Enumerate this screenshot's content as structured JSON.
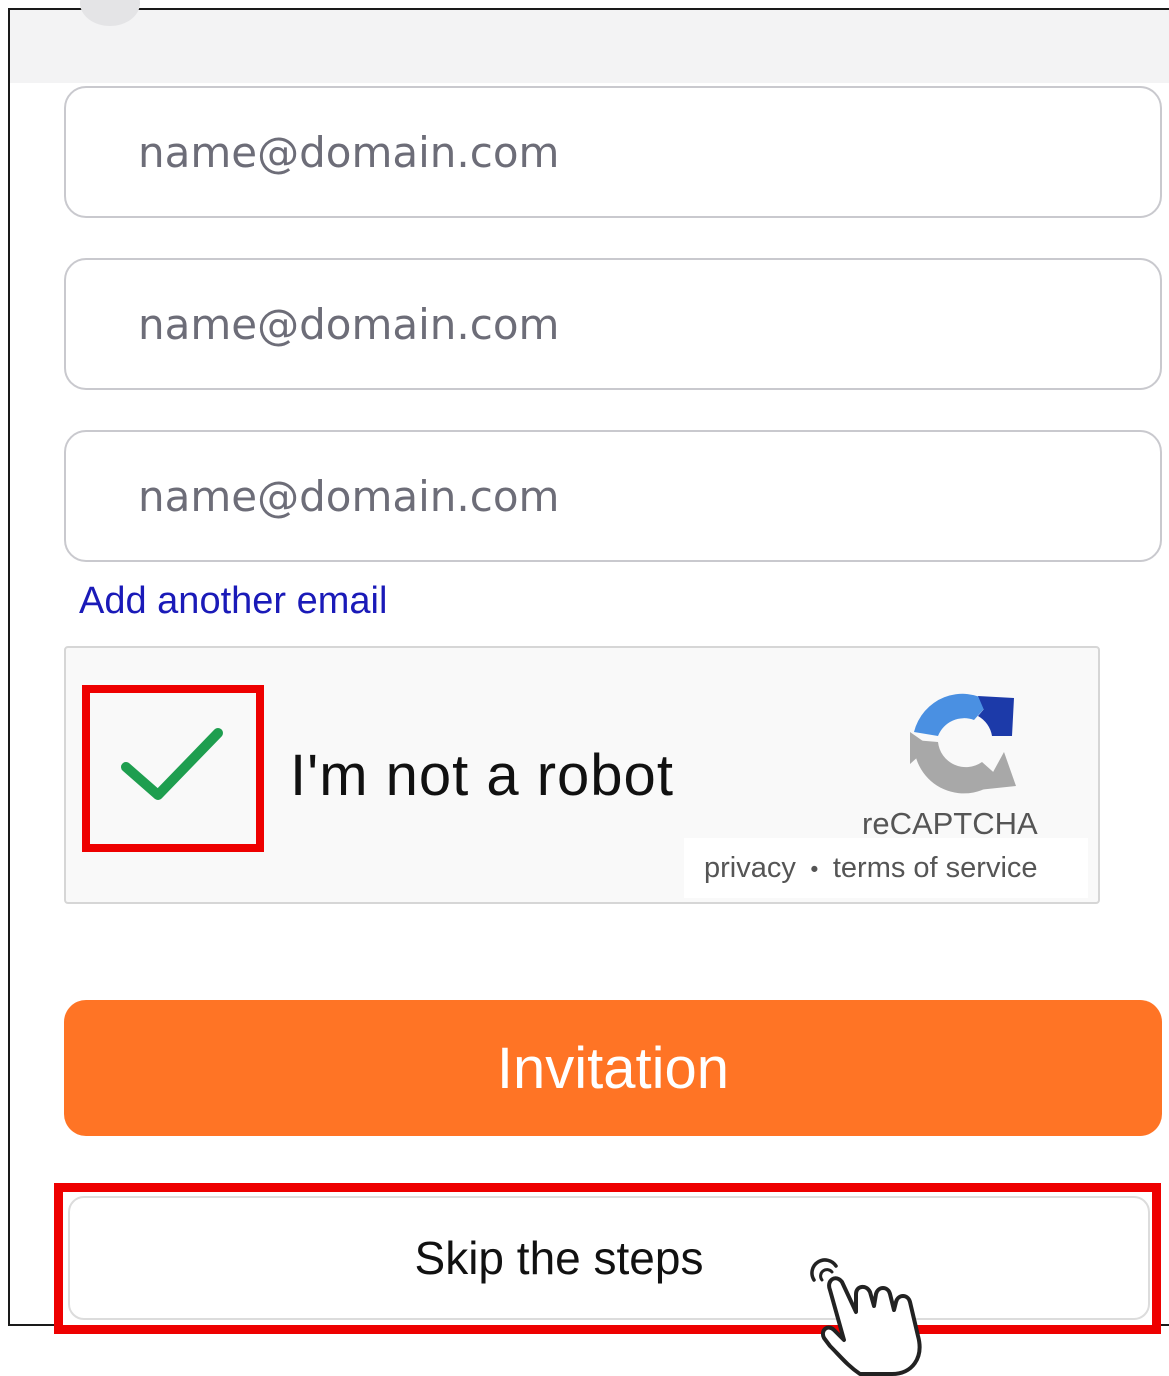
{
  "form": {
    "email_fields": [
      {
        "value": "",
        "placeholder": "name@domain.com"
      },
      {
        "value": "",
        "placeholder": "name@domain.com"
      },
      {
        "value": "",
        "placeholder": "name@domain.com"
      }
    ],
    "add_email_label": "Add another email"
  },
  "recaptcha": {
    "checked": true,
    "label": "I'm not a robot",
    "brand": "reCAPTCHA",
    "privacy_label": "privacy",
    "separator": "・",
    "terms_label": "terms of service",
    "check_color": "#1e9e4f"
  },
  "actions": {
    "invite_label": "Invitation",
    "skip_label": "Skip the steps",
    "invite_color": "#ff7425",
    "highlight_color": "#ee0000"
  },
  "icons": {
    "check": "checkmark-icon",
    "recaptcha_logo": "recaptcha-logo-icon",
    "pointer": "hand-pointer-icon"
  }
}
